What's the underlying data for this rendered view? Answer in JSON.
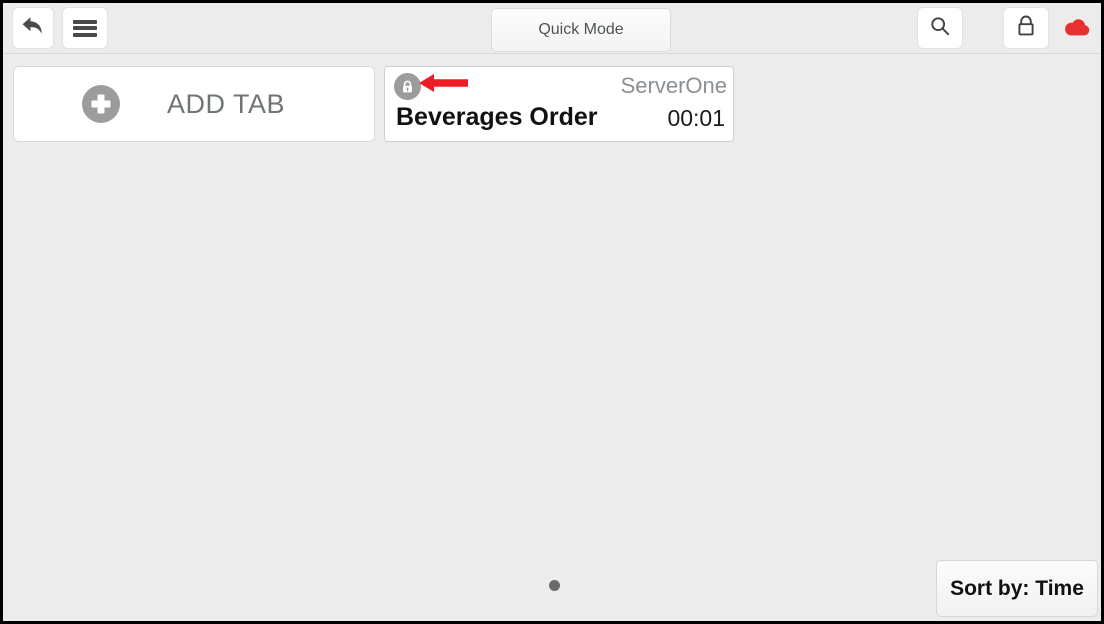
{
  "header": {
    "back_icon": "back-arrow-icon",
    "menu_icon": "hamburger-menu-icon",
    "quick_mode_label": "Quick Mode",
    "search_icon": "search-icon",
    "lock_icon": "lock-icon",
    "cloud_icon": "cloud-icon",
    "cloud_color": "#e8302f"
  },
  "tabs": {
    "add_tab": {
      "label": "ADD TAB",
      "icon": "plus-circle-icon"
    },
    "items": [
      {
        "lock_icon": "locked-padlock-icon",
        "server": "ServerOne",
        "title": "Beverages Order",
        "time": "00:01"
      }
    ]
  },
  "annotation": {
    "arrow": "red-left-arrow",
    "color": "#ee1c25"
  },
  "footer": {
    "page_indicator": "page-dot",
    "sort_label": "Sort by: Time"
  }
}
